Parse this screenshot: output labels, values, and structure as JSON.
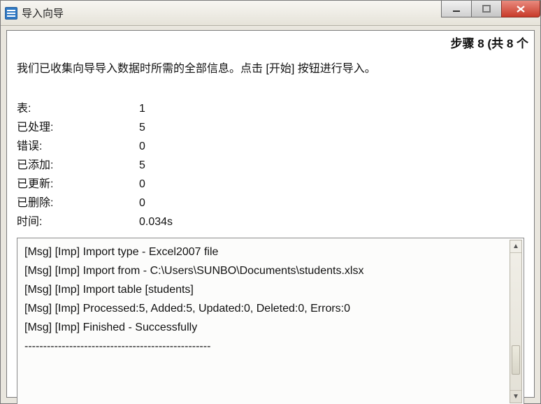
{
  "window": {
    "title": "导入向导"
  },
  "step": {
    "text": "步骤 8 (共 8 个"
  },
  "intro": "我们已收集向导导入数据时所需的全部信息。点击 [开始] 按钮进行导入。",
  "stats": {
    "rows": [
      {
        "label": "表:",
        "value": "1"
      },
      {
        "label": "已处理:",
        "value": "5"
      },
      {
        "label": "错误:",
        "value": "0"
      },
      {
        "label": "已添加:",
        "value": "5"
      },
      {
        "label": "已更新:",
        "value": "0"
      },
      {
        "label": "已删除:",
        "value": "0"
      },
      {
        "label": "时间:",
        "value": "0.034s"
      }
    ]
  },
  "log": {
    "lines": [
      "[Msg] [Imp] Import type - Excel2007 file",
      "[Msg] [Imp] Import from - C:\\Users\\SUNBO\\Documents\\students.xlsx",
      "[Msg] [Imp] Import table [students]",
      "[Msg] [Imp] Processed:5, Added:5, Updated:0, Deleted:0, Errors:0",
      "[Msg] [Imp] Finished - Successfully",
      "--------------------------------------------------"
    ]
  }
}
